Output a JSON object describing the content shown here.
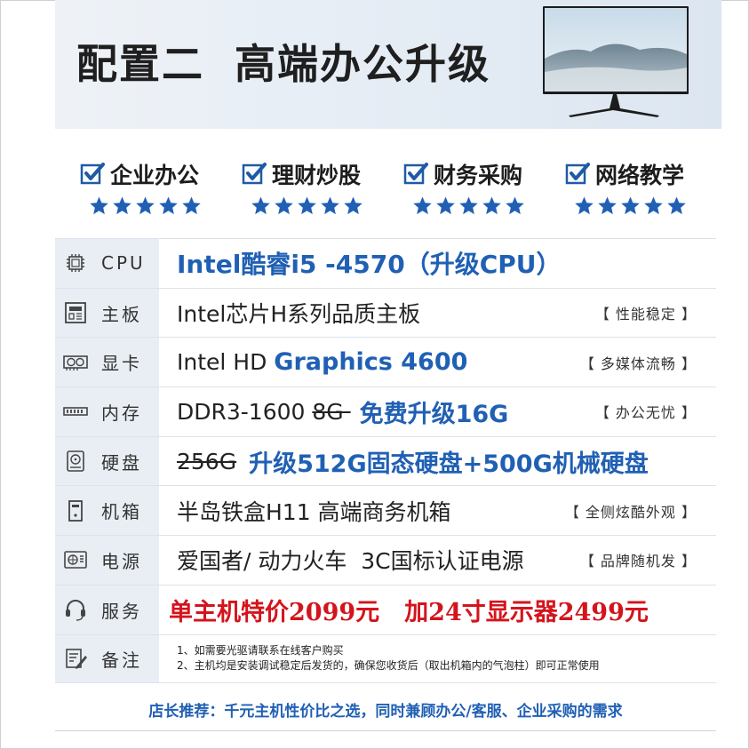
{
  "header": {
    "title_part1": "配置二",
    "title_part2": "高端办公升级"
  },
  "features": [
    {
      "label": "企业办公",
      "stars": 5
    },
    {
      "label": "理财炒股",
      "stars": 5
    },
    {
      "label": "财务采购",
      "stars": 5
    },
    {
      "label": "网络教学",
      "stars": 5
    }
  ],
  "colors": {
    "accent_blue": "#2060b4",
    "price_red": "#d4141c",
    "label_bg": "#e9eef4"
  },
  "specs": {
    "cpu": {
      "icon": "cpu-icon",
      "label": "CPU",
      "value": "Intel酷睿i5 -4570（升级CPU）"
    },
    "board": {
      "icon": "motherboard-icon",
      "label": "主板",
      "value": "Intel芯片H系列品质主板",
      "note": "【 性能稳定 】"
    },
    "gpu": {
      "icon": "graphics-card-icon",
      "label": "显卡",
      "value_plain": "Intel HD ",
      "value_blue": "Graphics 4600",
      "note": "【 多媒体流畅 】"
    },
    "ram": {
      "icon": "memory-icon",
      "label": "内存",
      "value_plain": "DDR3-1600 ",
      "value_strike": "8G ",
      "value_blue": "免费升级16G",
      "note": "【 办公无忧 】"
    },
    "disk": {
      "icon": "hard-disk-icon",
      "label": "硬盘",
      "value_strike": "256G",
      "value_blue": "升级512G固态硬盘+500G机械硬盘"
    },
    "case": {
      "icon": "case-icon",
      "label": "机箱",
      "value": "半岛铁盒H11 高端商务机箱",
      "note": "【 全侧炫酷外观 】"
    },
    "psu": {
      "icon": "power-supply-icon",
      "label": "电源",
      "value": "爱国者/ 动力火车  3C国标认证电源",
      "note": "【 品牌随机发 】"
    },
    "service": {
      "icon": "headset-icon",
      "label": "服务",
      "price1": "单主机特价2099元",
      "price2": "加24寸显示器2499元"
    },
    "remarks": {
      "icon": "edit-icon",
      "label": "备注",
      "line1": "1、如需要光驱请联系在线客户购买",
      "line2": "2、主机均是安装调试稳定后发货的，确保您收货后（取出机箱内的气泡柱）即可正常使用"
    }
  },
  "footer": {
    "text": "店长推荐：千元主机性价比之选，同时兼顾办公/客服、企业采购的需求"
  }
}
